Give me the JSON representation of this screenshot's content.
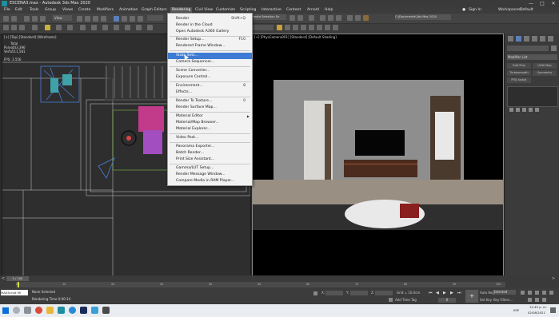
{
  "window": {
    "title": "ESCENA3.max - Autodesk 3ds Max 2020",
    "controls": [
      "—",
      "□",
      "✕"
    ]
  },
  "menubar": {
    "items": [
      "File",
      "Edit",
      "Tools",
      "Group",
      "Views",
      "Create",
      "Modifiers",
      "Animation",
      "Graph Editors",
      "Rendering",
      "Civil View",
      "Customize",
      "Scripting",
      "Interactive",
      "Content",
      "Arnold",
      "Help"
    ],
    "active": "Rendering",
    "sign_in": "Sign In",
    "workspaces_label": "Workspaces:",
    "workspaces_value": "Default"
  },
  "toolbar": {
    "view_dropdown": "View",
    "selection_set": "Create Selection Se",
    "path_field": "C:\\Documents\\3ds Max 2020"
  },
  "rendering_menu": {
    "items": [
      {
        "label": "Render",
        "shortcut": "Shift+Q"
      },
      {
        "label": "Render in the Cloud",
        "shortcut": ""
      },
      {
        "label": "Open Autodesk A360 Gallery",
        "shortcut": ""
      },
      {
        "label": "Render Setup...",
        "shortcut": "F10"
      },
      {
        "label": "Rendered Frame Window...",
        "shortcut": ""
      },
      {
        "label": "State Sets...",
        "shortcut": ""
      },
      {
        "label": "Camera Sequencer...",
        "shortcut": ""
      },
      {
        "label": "Scene Converter...",
        "shortcut": ""
      },
      {
        "label": "Exposure Control...",
        "shortcut": ""
      },
      {
        "label": "Environment...",
        "shortcut": "8"
      },
      {
        "label": "Effects...",
        "shortcut": ""
      },
      {
        "label": "Render To Texture...",
        "shortcut": "0"
      },
      {
        "label": "Render Surface Map...",
        "shortcut": ""
      },
      {
        "label": "Material Editor",
        "shortcut": ""
      },
      {
        "label": "Material/Map Browser...",
        "shortcut": ""
      },
      {
        "label": "Material Explorer...",
        "shortcut": ""
      },
      {
        "label": "Video Post...",
        "shortcut": ""
      },
      {
        "label": "Panorama Exporter...",
        "shortcut": ""
      },
      {
        "label": "Batch Render...",
        "shortcut": ""
      },
      {
        "label": "Print Size Assistant...",
        "shortcut": ""
      },
      {
        "label": "Gamma/LUT Setup...",
        "shortcut": ""
      },
      {
        "label": "Render Message Window...",
        "shortcut": ""
      },
      {
        "label": "Compare Media in RAM Player...",
        "shortcut": ""
      }
    ],
    "highlighted": "State Sets..."
  },
  "viewport_left": {
    "label": "[+] [Top] [Standard] [Wireframe]",
    "stats_total": "Total",
    "stats_polys_label": "Polys:",
    "stats_polys": "443,396",
    "stats_verts_label": "Verts:",
    "stats_verts": "511,581",
    "fps_label": "FPS:",
    "fps": "3.556"
  },
  "viewport_right": {
    "label": "[+] [PhysCamera001] [Standard] [Default Shading]"
  },
  "command_panel": {
    "modifier_list": "Modifier List",
    "buttons": [
      "Edit Poly",
      "UVW Map",
      "Turbosmooth",
      "Symmetry",
      "FFD 4x4x4"
    ]
  },
  "timeline": {
    "frame": "0 / 100",
    "ticks": [
      "0",
      "5",
      "10",
      "15",
      "20",
      "25",
      "30",
      "35",
      "40",
      "45",
      "50",
      "55",
      "60",
      "65",
      "70",
      "75",
      "80",
      "85",
      "90",
      "95",
      "100"
    ]
  },
  "statusbar": {
    "maxscript": "MAXScript Mi",
    "selection": "None Selected",
    "rendering_time": "Rendering Time 0:00:14",
    "x_label": "X:",
    "y_label": "Y:",
    "z_label": "Z:",
    "grid": "Grid = 10.0cm",
    "add_time_tag": "Add Time Tag",
    "auto_key": "Auto Key",
    "auto_value": "Selected",
    "set_key": "Set Key",
    "key_filters": "Key Filters...",
    "frame_value": "0"
  },
  "taskbar": {
    "time": "12:45 p. m.",
    "date": "02/08/2021",
    "lang": "ESP"
  }
}
